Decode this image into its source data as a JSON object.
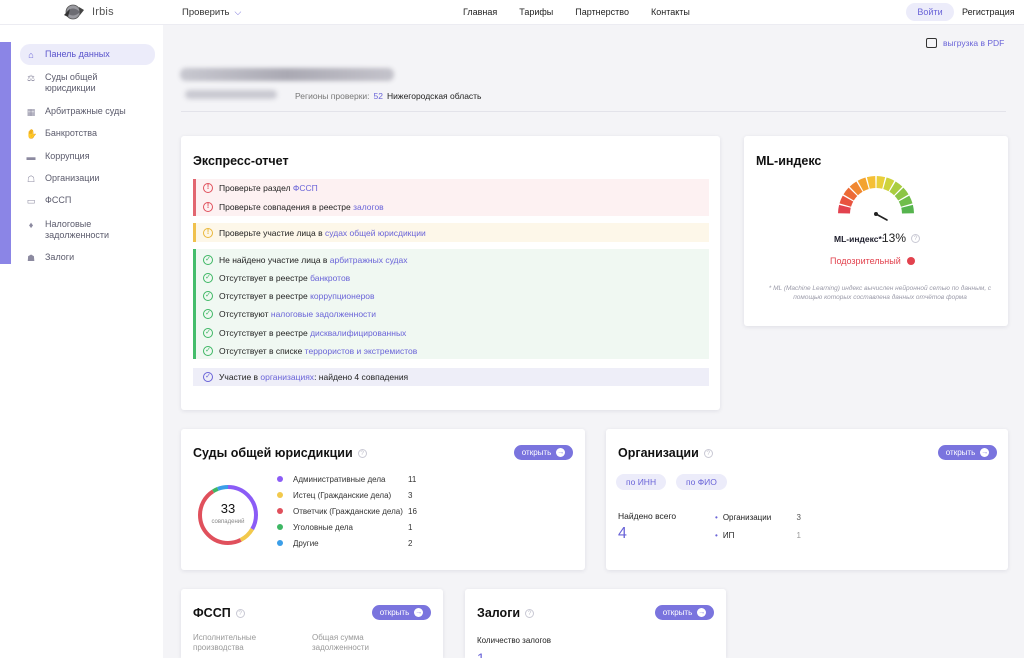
{
  "header": {
    "logo_text": "Irbis",
    "check_menu": "Проверить",
    "nav": [
      "Главная",
      "Тарифы",
      "Партнерство",
      "Контакты"
    ],
    "login": "Войти",
    "register": "Регистрация"
  },
  "sidebar": {
    "items": [
      {
        "label": "Панель данных",
        "icon": "home-icon",
        "active": true
      },
      {
        "label": "Суды общей юрисдикции",
        "icon": "scales-icon"
      },
      {
        "label": "Арбитражные суды",
        "icon": "building-icon"
      },
      {
        "label": "Банкротства",
        "icon": "handshake-icon"
      },
      {
        "label": "Коррупция",
        "icon": "briefcase-icon"
      },
      {
        "label": "Организации",
        "icon": "organization-icon"
      },
      {
        "label": "ФССП",
        "icon": "document-icon"
      },
      {
        "label": "Налоговые задолженности",
        "icon": "moneybag-icon"
      },
      {
        "label": "Залоги",
        "icon": "pledge-icon"
      }
    ]
  },
  "toolbar": {
    "pdf_label": "выгрузка в PDF"
  },
  "regions": {
    "label": "Регионы проверки:",
    "code": "52",
    "name": "Нижегородская область"
  },
  "express": {
    "title": "Экспресс-отчет",
    "red": [
      {
        "text": "Проверьте раздел ",
        "link": "ФССП"
      },
      {
        "text": "Проверьте совпадения в реестре ",
        "link": "залогов"
      }
    ],
    "yellow": [
      {
        "text": "Проверьте участие лица в ",
        "link": "судах общей юрисдикции"
      }
    ],
    "green": [
      {
        "text": "Не найдено участие лица в ",
        "link": "арбитражных судах"
      },
      {
        "text": "Отсутствует в реестре ",
        "link": "банкротов"
      },
      {
        "text": "Отсутствует в реестре ",
        "link": "коррупционеров"
      },
      {
        "text": "Отсутствуют ",
        "link": "налоговые задолженности"
      },
      {
        "text": "Отсутствует в реестре ",
        "link": "дисквалифицированных"
      },
      {
        "text": "Отсутствует в списке ",
        "link": "террористов и экстремистов"
      }
    ],
    "blue": {
      "text": "Участие в ",
      "link": "организациях",
      "suffix": ": найдено 4 совпадения"
    }
  },
  "ml": {
    "title": "ML-индекс",
    "label": "ML-индекс*:",
    "value": "13%",
    "status": "Подозрительный",
    "note": "* ML (Machine Learning) индекс вычислен нейронной сетью по данным, с помощью которых составлена данных отчётов форма",
    "colors": {
      "danger": "#e2424e"
    }
  },
  "courts": {
    "title": "Суды общей юрисдикции",
    "open": "открыть",
    "total": "33",
    "total_label": "совпадений",
    "legend": [
      {
        "label": "Административные дела",
        "value": "11",
        "color": "#8b5cf6"
      },
      {
        "label": "Истец (Гражданские дела)",
        "value": "3",
        "color": "#f2c94c"
      },
      {
        "label": "Ответчик (Гражданские дела)",
        "value": "16",
        "color": "#e0505c"
      },
      {
        "label": "Уголовные дела",
        "value": "1",
        "color": "#3eb764"
      },
      {
        "label": "Другие",
        "value": "2",
        "color": "#3b9ee8"
      }
    ]
  },
  "orgs": {
    "title": "Организации",
    "open": "открыть",
    "chips": [
      "по ИНН",
      "по ФИО"
    ],
    "found_label": "Найдено всего",
    "found_value": "4",
    "rows": [
      {
        "label": "Организации",
        "value": "3"
      },
      {
        "label": "ИП",
        "value": "1"
      }
    ]
  },
  "fssp": {
    "title": "ФССП",
    "open": "открыть",
    "col1": "Исполнительные производства",
    "col2": "Общая сумма задолженности"
  },
  "pledges": {
    "title": "Залоги",
    "open": "открыть",
    "count_label": "Количество залогов",
    "count_value": "1"
  }
}
